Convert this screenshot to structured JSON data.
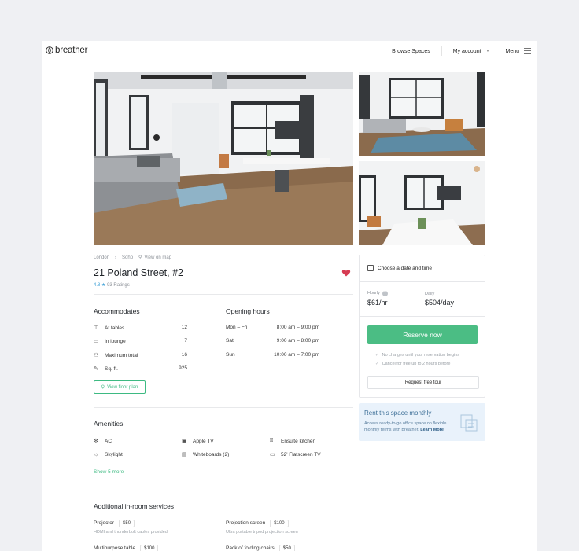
{
  "nav": {
    "brand": "breather",
    "browse": "Browse Spaces",
    "account": "My account",
    "menu": "Menu"
  },
  "breadcrumb": {
    "city": "London",
    "area": "Soho",
    "map": "View on map"
  },
  "listing": {
    "title": "21 Poland Street, #2",
    "rating_value": "4.8",
    "rating_count": "93 Ratings"
  },
  "accommodates": {
    "heading": "Accommodates",
    "items": [
      {
        "label": "At tables",
        "value": "12",
        "icon": "table-icon"
      },
      {
        "label": "In lounge",
        "value": "7",
        "icon": "sofa-icon"
      },
      {
        "label": "Maximum total",
        "value": "16",
        "icon": "people-icon"
      },
      {
        "label": "Sq. ft.",
        "value": "925",
        "icon": "ruler-icon"
      }
    ],
    "floor_plan": "View floor plan"
  },
  "hours": {
    "heading": "Opening hours",
    "items": [
      {
        "day": "Mon – Fri",
        "time": "8:00 am – 9:00 pm"
      },
      {
        "day": "Sat",
        "time": "9:00 am – 8:00 pm"
      },
      {
        "day": "Sun",
        "time": "10:00 am – 7:00 pm"
      }
    ]
  },
  "amenities": {
    "heading": "Amenities",
    "items": [
      "AC",
      "Apple TV",
      "Ensuite kitchen",
      "Skylight",
      "Whiteboards (2)",
      "52' Flatscreen TV"
    ],
    "more": "Show 5 more"
  },
  "services": {
    "heading": "Additional in-room services",
    "items": [
      {
        "name": "Projector",
        "price": "$50",
        "desc": "HDMI and thunderbolt cables provided"
      },
      {
        "name": "Projection screen",
        "price": "$100",
        "desc": "Ultra portable tripod projection screen"
      },
      {
        "name": "Multipurpose table",
        "price": "$100",
        "desc": ""
      },
      {
        "name": "Pack of folding chairs",
        "price": "$50",
        "desc": ""
      }
    ]
  },
  "booking": {
    "date_label": "Choose a date and time",
    "hourly_label": "Hourly",
    "hourly_price": "$61/hr",
    "daily_label": "Daily",
    "daily_price": "$504/day",
    "reserve": "Reserve now",
    "note1": "No charges until your reservation begins",
    "note2": "Cancel for free up to 2 hours before",
    "tour": "Request free tour"
  },
  "monthly": {
    "title": "Rent this space monthly",
    "desc": "Access ready-to-go office space on flexible monthly terms with Breather.",
    "link": "Learn More"
  },
  "colors": {
    "accent_green": "#4bbd84",
    "rating_blue": "#3b9fd6",
    "heart_red": "#d63b52",
    "monthly_bg": "#e9f2fb"
  }
}
